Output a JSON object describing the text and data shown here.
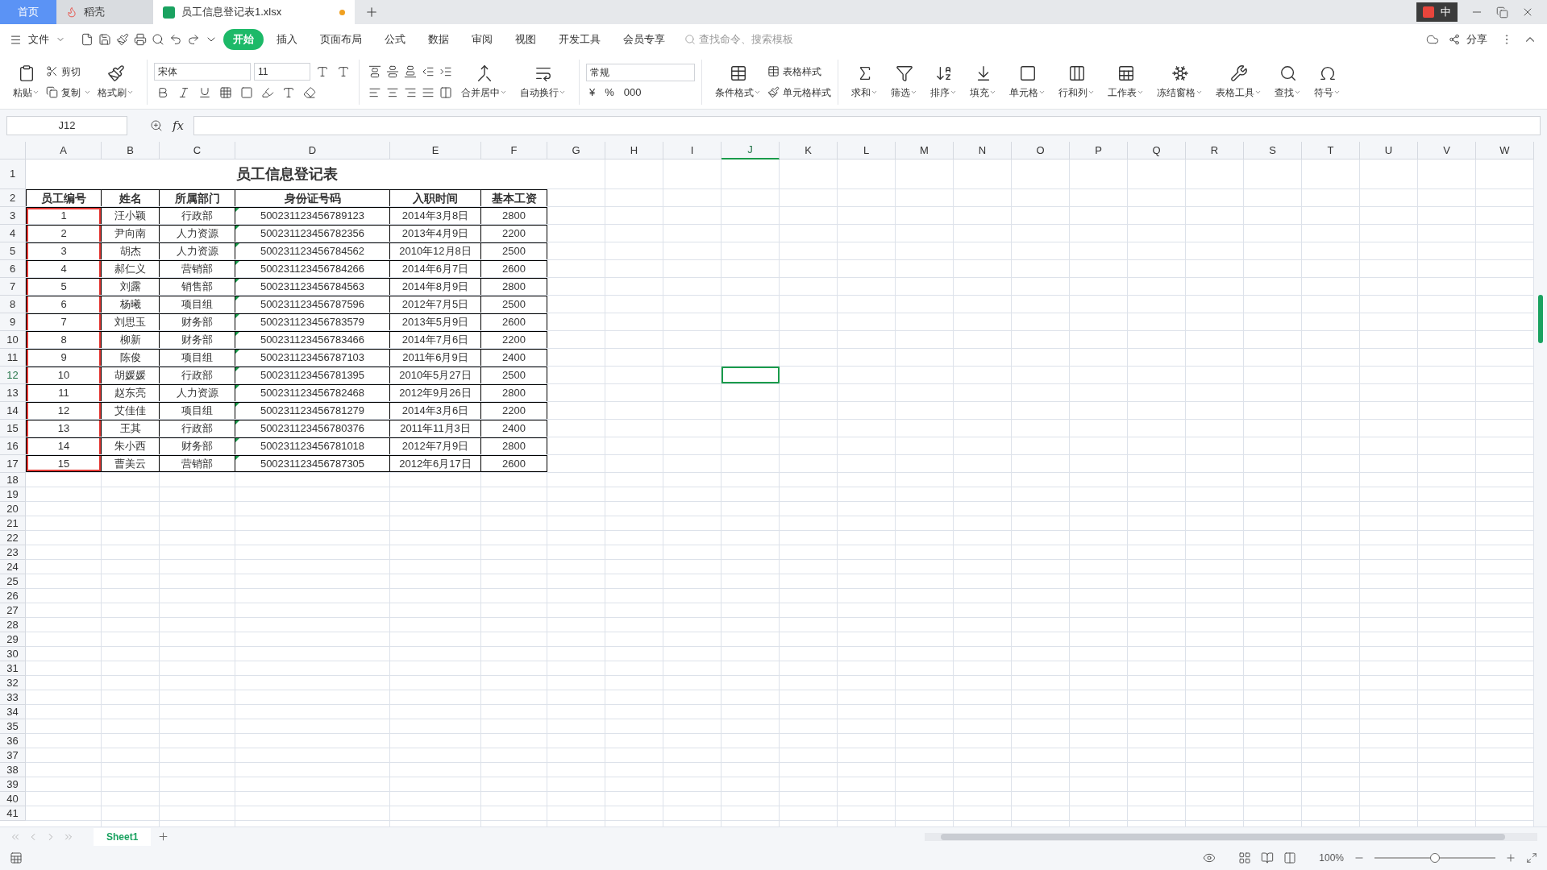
{
  "title_tabs": [
    {
      "label": "首页",
      "selected": false,
      "kind": "home"
    },
    {
      "label": "稻壳",
      "selected": false,
      "kind": "app"
    },
    {
      "label": "员工信息登记表1.xlsx",
      "selected": true,
      "kind": "doc",
      "unsaved": true
    }
  ],
  "ime_bar": {
    "label": "中"
  },
  "menu": {
    "file": "文件",
    "items": [
      {
        "label": "开始",
        "selected": true
      },
      {
        "label": "插入",
        "selected": false
      },
      {
        "label": "页面布局",
        "selected": false
      },
      {
        "label": "公式",
        "selected": false
      },
      {
        "label": "数据",
        "selected": false
      },
      {
        "label": "审阅",
        "selected": false
      },
      {
        "label": "视图",
        "selected": false
      },
      {
        "label": "开发工具",
        "selected": false
      },
      {
        "label": "会员专享",
        "selected": false
      }
    ],
    "search": {
      "placeholder": "查找命令、搜索模板"
    },
    "share": "分享"
  },
  "ribbon": {
    "paste": "粘贴",
    "cut": "剪切",
    "copy": "复制",
    "format_painter": "格式刷",
    "font": {
      "name": "宋体",
      "size": "11"
    },
    "merge": "合并居中",
    "wrap": "自动换行",
    "number_format": "常规",
    "number_symbols": [
      "¥",
      "%",
      "000"
    ],
    "table_style": "表格样式",
    "cell_style": "单元格样式",
    "conditional_format": "条件格式",
    "tools": [
      {
        "label": "求和",
        "kind": "sum"
      },
      {
        "label": "筛选",
        "kind": "filter"
      },
      {
        "label": "排序",
        "kind": "sort"
      },
      {
        "label": "填充",
        "kind": "fill"
      },
      {
        "label": "单元格",
        "kind": "cell"
      },
      {
        "label": "行和列",
        "kind": "rowcol"
      },
      {
        "label": "工作表",
        "kind": "sheet"
      },
      {
        "label": "冻结窗格",
        "kind": "freeze"
      },
      {
        "label": "表格工具",
        "kind": "tool"
      },
      {
        "label": "查找",
        "kind": "find"
      },
      {
        "label": "符号",
        "kind": "symbol"
      }
    ]
  },
  "formula_bar": {
    "cell_ref": "J12",
    "fx": "fx"
  },
  "sheet": {
    "columns": [
      {
        "label": "A",
        "selected": false,
        "outlined": true
      },
      {
        "label": "B",
        "selected": false,
        "outlined": false
      },
      {
        "label": "C",
        "selected": false,
        "outlined": false
      },
      {
        "label": "D",
        "selected": false,
        "outlined": false
      },
      {
        "label": "E",
        "selected": false,
        "outlined": false
      },
      {
        "label": "F",
        "selected": false,
        "outlined": false
      },
      {
        "label": "G",
        "selected": false,
        "outlined": false
      },
      {
        "label": "H",
        "selected": false,
        "outlined": false
      },
      {
        "label": "I",
        "selected": false,
        "outlined": false
      },
      {
        "label": "J",
        "selected": true,
        "outlined": false
      },
      {
        "label": "K",
        "selected": false,
        "outlined": false
      },
      {
        "label": "L",
        "selected": false,
        "outlined": false
      },
      {
        "label": "M",
        "selected": false,
        "outlined": false
      },
      {
        "label": "N",
        "selected": false,
        "outlined": false
      },
      {
        "label": "O",
        "selected": false,
        "outlined": false
      },
      {
        "label": "P",
        "selected": false,
        "outlined": false
      },
      {
        "label": "Q",
        "selected": false,
        "outlined": false
      },
      {
        "label": "R",
        "selected": false,
        "outlined": false
      },
      {
        "label": "S",
        "selected": false,
        "outlined": false
      },
      {
        "label": "T",
        "selected": false,
        "outlined": false
      },
      {
        "label": "U",
        "selected": false,
        "outlined": false
      },
      {
        "label": "V",
        "selected": false,
        "outlined": false
      },
      {
        "label": "W",
        "selected": false,
        "outlined": false
      }
    ],
    "title_row": {
      "number": "1",
      "selected": false,
      "text": "员工信息登记表"
    },
    "header_row": {
      "number": "2",
      "selected": false,
      "cells": [
        "员工编号",
        "姓名",
        "所属部门",
        "身份证号码",
        "入职时间",
        "基本工资"
      ]
    },
    "rows": [
      {
        "number": "3",
        "selected": false,
        "cells": [
          "1",
          "汪小颖",
          "行政部",
          "500231123456789123",
          "2014年3月8日",
          "2800"
        ]
      },
      {
        "number": "4",
        "selected": false,
        "cells": [
          "2",
          "尹向南",
          "人力资源",
          "500231123456782356",
          "2013年4月9日",
          "2200"
        ]
      },
      {
        "number": "5",
        "selected": false,
        "cells": [
          "3",
          "胡杰",
          "人力资源",
          "500231123456784562",
          "2010年12月8日",
          "2500"
        ]
      },
      {
        "number": "6",
        "selected": false,
        "cells": [
          "4",
          "郝仁义",
          "营销部",
          "500231123456784266",
          "2014年6月7日",
          "2600"
        ]
      },
      {
        "number": "7",
        "selected": false,
        "cells": [
          "5",
          "刘露",
          "销售部",
          "500231123456784563",
          "2014年8月9日",
          "2800"
        ]
      },
      {
        "number": "8",
        "selected": false,
        "cells": [
          "6",
          "杨曦",
          "项目组",
          "500231123456787596",
          "2012年7月5日",
          "2500"
        ]
      },
      {
        "number": "9",
        "selected": false,
        "cells": [
          "7",
          "刘思玉",
          "财务部",
          "500231123456783579",
          "2013年5月9日",
          "2600"
        ]
      },
      {
        "number": "10",
        "selected": false,
        "cells": [
          "8",
          "柳新",
          "财务部",
          "500231123456783466",
          "2014年7月6日",
          "2200"
        ]
      },
      {
        "number": "11",
        "selected": false,
        "cells": [
          "9",
          "陈俊",
          "项目组",
          "500231123456787103",
          "2011年6月9日",
          "2400"
        ]
      },
      {
        "number": "12",
        "selected": true,
        "cells": [
          "10",
          "胡媛媛",
          "行政部",
          "500231123456781395",
          "2010年5月27日",
          "2500"
        ]
      },
      {
        "number": "13",
        "selected": false,
        "cells": [
          "11",
          "赵东亮",
          "人力资源",
          "500231123456782468",
          "2012年9月26日",
          "2800"
        ]
      },
      {
        "number": "14",
        "selected": false,
        "cells": [
          "12",
          "艾佳佳",
          "项目组",
          "500231123456781279",
          "2014年3月6日",
          "2200"
        ]
      },
      {
        "number": "15",
        "selected": false,
        "cells": [
          "13",
          "王其",
          "行政部",
          "500231123456780376",
          "2011年11月3日",
          "2400"
        ]
      },
      {
        "number": "16",
        "selected": false,
        "cells": [
          "14",
          "朱小西",
          "财务部",
          "500231123456781018",
          "2012年7月9日",
          "2800"
        ]
      },
      {
        "number": "17",
        "selected": false,
        "cells": [
          "15",
          "曹美云",
          "营销部",
          "500231123456787305",
          "2012年6月17日",
          "2600"
        ]
      }
    ],
    "empty_rows": [
      "18",
      "19",
      "20",
      "21",
      "22",
      "23",
      "24",
      "25",
      "26",
      "27",
      "28",
      "29",
      "30",
      "31",
      "32",
      "33",
      "34",
      "35",
      "36",
      "37",
      "38",
      "39",
      "40",
      "41"
    ]
  },
  "sheet_tabs": [
    {
      "label": "Sheet1",
      "selected": true
    }
  ],
  "status_bar": {
    "zoom": "100%",
    "zoom_slider": {
      "level": 0.5
    }
  }
}
